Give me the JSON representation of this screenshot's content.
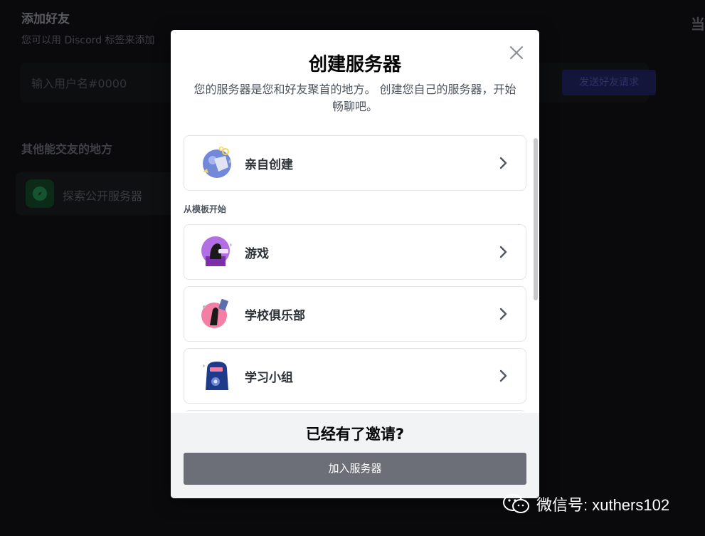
{
  "background": {
    "title": "添加好友",
    "subtitle": "您可以用 Discord 标签来添加",
    "corner_text": "当",
    "input_placeholder": "输入用户名#0000",
    "send_button": "发送好友请求",
    "section_title": "其他能交友的地方",
    "explore_label": "探索公开服务器"
  },
  "modal": {
    "title": "创建服务器",
    "description": "您的服务器是您和好友聚首的地方。 创建您自己的服务器，开始畅聊吧。",
    "create_own": "亲自创建",
    "templates_heading": "从模板开始",
    "templates": [
      {
        "label": "游戏",
        "icon": "gaming-icon"
      },
      {
        "label": "学校俱乐部",
        "icon": "school-club-icon"
      },
      {
        "label": "学习小组",
        "icon": "study-group-icon"
      }
    ],
    "footer_title": "已经有了邀请?",
    "join_button": "加入服务器"
  },
  "watermark": "微信号: xuthers102",
  "colors": {
    "overlay_bg": "#0a0a0c",
    "modal_bg": "#ffffff",
    "footer_bg": "#f2f3f5",
    "join_button_bg": "#6d6f78"
  }
}
